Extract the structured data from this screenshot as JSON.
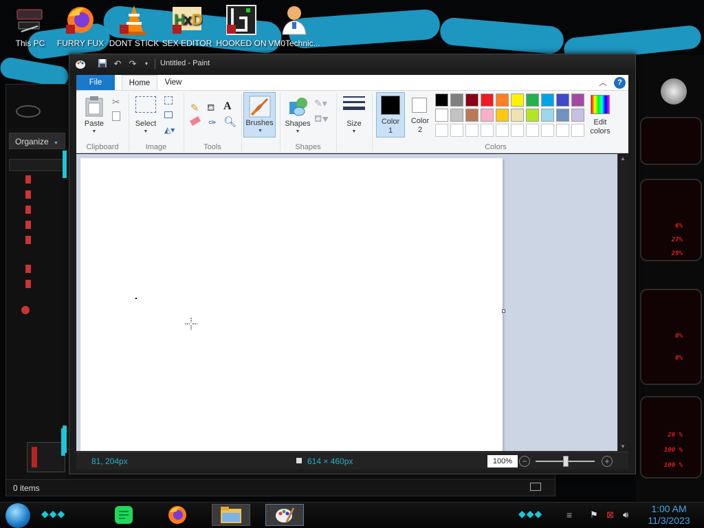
{
  "desktop": {
    "icons": [
      {
        "label": "This PC"
      },
      {
        "label": "FURRY FUX"
      },
      {
        "label": "DONT STICK"
      },
      {
        "label": "SEX EDITOR"
      },
      {
        "label": "HOOKED ON"
      },
      {
        "label": "VM0Technic..."
      }
    ]
  },
  "explorer": {
    "organize_label": "Organize",
    "status_text": "0 items"
  },
  "paint": {
    "title": "Untitled - Paint",
    "tabs": {
      "file": "File",
      "home": "Home",
      "view": "View"
    },
    "ribbon": {
      "clipboard": {
        "paste": "Paste",
        "group": "Clipboard"
      },
      "image": {
        "select": "Select",
        "group": "Image"
      },
      "tools": {
        "group": "Tools"
      },
      "brushes": {
        "label": "Brushes"
      },
      "shapes": {
        "label": "Shapes",
        "group": "Shapes"
      },
      "size": {
        "label": "Size"
      },
      "colors": {
        "color1_label": "Color\n1",
        "color1_a": "Color",
        "color1_b": "1",
        "color2_a": "Color",
        "color2_b": "2",
        "edit_a": "Edit",
        "edit_b": "colors",
        "group": "Colors",
        "color1_value": "#000000",
        "color2_value": "#ffffff",
        "palette_row1": [
          "#000000",
          "#7f7f7f",
          "#880015",
          "#ed1c24",
          "#ff7f27",
          "#fff200",
          "#22b14c",
          "#00a2e8",
          "#3f48cc",
          "#a349a4"
        ],
        "palette_row2": [
          "#ffffff",
          "#c3c3c3",
          "#b97a57",
          "#ffaec9",
          "#ffc90e",
          "#efe4b0",
          "#b5e61d",
          "#99d9ea",
          "#7092be",
          "#c8bfe7"
        ]
      }
    },
    "status": {
      "cursor_pos": "81, 204px",
      "canvas_size": "614 × 460px",
      "zoom": "100%"
    }
  },
  "gadget": {
    "values": [
      "6%",
      "27%",
      "29%",
      "0%",
      "0%",
      "26 %",
      "100 %",
      "100 %"
    ],
    "accent": "#e02020"
  },
  "taskbar": {
    "time": "1:00 AM",
    "date": "11/3/2023"
  }
}
